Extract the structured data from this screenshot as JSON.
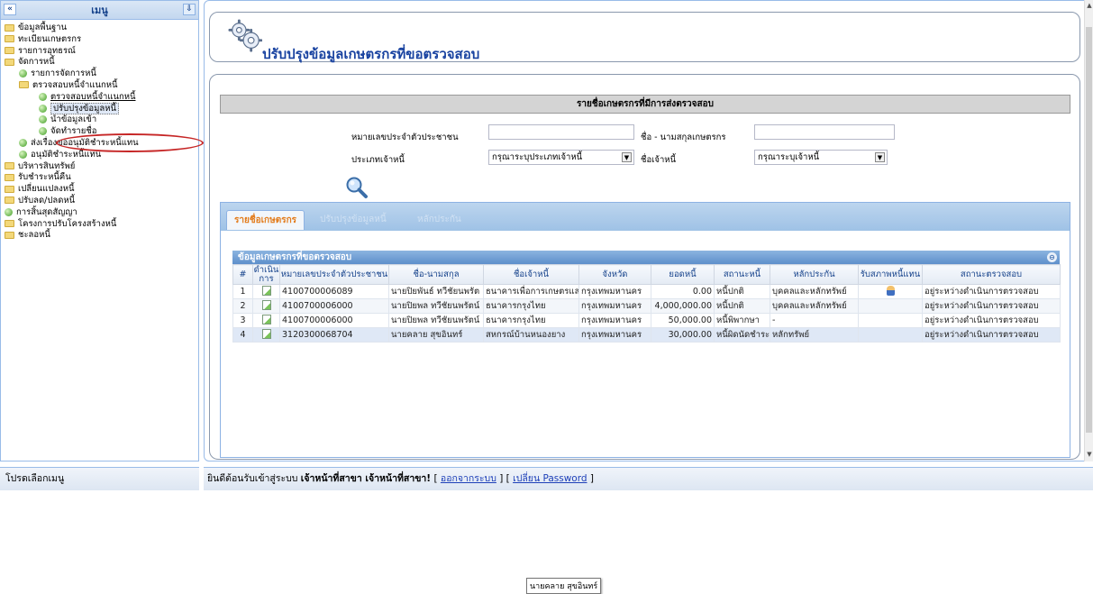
{
  "sidebar": {
    "title": "เมนู",
    "collapse_glyph": "«",
    "pin_glyph": "⇩",
    "items": [
      {
        "label": "ข้อมูลพื้นฐาน",
        "type": "folder"
      },
      {
        "label": "ทะเบียนเกษตรกร",
        "type": "folder"
      },
      {
        "label": "รายการอุทธรณ์",
        "type": "folder"
      },
      {
        "label": "จัดการหนี้",
        "type": "folder"
      },
      {
        "label": "รายการจัดการหนี้",
        "type": "leaf"
      },
      {
        "label": "ตรวจสอบหนี้จำแนกหนี้",
        "type": "folder"
      },
      {
        "label": "ตรวจสอบหนี้จำแนกหนี้",
        "type": "leaf"
      },
      {
        "label": "ปรับปรุงข้อมูลหนี้",
        "type": "leaf"
      },
      {
        "label": "นำข้อมูลเข้า",
        "type": "leaf"
      },
      {
        "label": "จัดทำรายชื่อ",
        "type": "leaf"
      },
      {
        "label": "ส่งเรื่องขออนุมัติชำระหนี้แทน",
        "type": "leaf"
      },
      {
        "label": "อนุมัติชำระหนี้แทน",
        "type": "leaf"
      },
      {
        "label": "บริหารสินทรัพย์",
        "type": "folder"
      },
      {
        "label": "รับชำระหนี้คืน",
        "type": "folder"
      },
      {
        "label": "เปลี่ยนแปลงหนี้",
        "type": "folder"
      },
      {
        "label": "ปรับลด/ปลดหนี้",
        "type": "folder"
      },
      {
        "label": "การสิ้นสุดสัญญา",
        "type": "leaf"
      },
      {
        "label": "โครงการปรับโครงสร้างหนี้",
        "type": "folder"
      },
      {
        "label": "ชะลอหนี้",
        "type": "folder"
      }
    ],
    "status": "โปรดเลือกเมนู"
  },
  "page": {
    "title": "ปรับปรุงข้อมูลเกษตรกรที่ขอตรวจสอบ",
    "list_title": "รายชื่อเกษตรกรที่มีการส่งตรวจสอบ"
  },
  "filters": {
    "id_label": "หมายเลขประจำตัวประชาชน",
    "name_label": "ชื่อ - นามสกุลเกษตรกร",
    "creditor_type_label": "ประเภทเจ้าหนี้",
    "creditor_type_value": "กรุณาระบุประเภทเจ้าหนี้",
    "creditor_label": "ชื่อเจ้าหนี้",
    "creditor_value": "กรุณาระบุเจ้าหนี้"
  },
  "tabs": [
    "รายชื่อเกษตรกร",
    "ปรับปรุงข้อมูลหนี้",
    "หลักประกัน"
  ],
  "grid": {
    "title": "ข้อมูลเกษตรกรที่ขอตรวจสอบ",
    "columns": [
      "#",
      "ดำเนินการ",
      "หมายเลขประจำตัวประชาชน",
      "ชื่อ-นามสกุล",
      "ชื่อเจ้าหนี้",
      "จังหวัด",
      "ยอดหนี้",
      "สถานะหนี้",
      "หลักประกัน",
      "รับสภาพหนี้แทน",
      "สถานะตรวจสอบ"
    ],
    "rows": [
      {
        "no": "1",
        "id": "4100700006089",
        "name": "นายปิยพันธ์ ทวีชัยนพรัต",
        "creditor": "ธนาคารเพื่อการเกษตรและสหกรณ์",
        "province": "กรุงเทพมหานคร",
        "amount": "0.00",
        "status": "หนี้ปกติ",
        "collateral": "บุคคลและหลักทรัพย์",
        "assume": "user-icon",
        "check": "อยู่ระหว่างดำเนินการตรวจสอบ"
      },
      {
        "no": "2",
        "id": "4100700006000",
        "name": "นายปิยพล ทวีชัยนพรัตน์",
        "creditor": "ธนาคารกรุงไทย",
        "province": "กรุงเทพมหานคร",
        "amount": "4,000,000.00",
        "status": "หนี้ปกติ",
        "collateral": "บุคคลและหลักทรัพย์",
        "assume": "",
        "check": "อยู่ระหว่างดำเนินการตรวจสอบ"
      },
      {
        "no": "3",
        "id": "4100700006000",
        "name": "นายปิยพล ทวีชัยนพรัตน์",
        "creditor": "ธนาคารกรุงไทย",
        "province": "กรุงเทพมหานคร",
        "amount": "50,000.00",
        "status": "หนี้พิพากษา",
        "collateral": "-",
        "assume": "",
        "check": "อยู่ระหว่างดำเนินการตรวจสอบ"
      },
      {
        "no": "4",
        "id": "3120300068704",
        "name": "นายคลาย สุขอินทร์",
        "creditor": "สหกรณ์บ้านหนองยาง",
        "province": "กรุงเทพมหานคร",
        "amount": "30,000.00",
        "status": "หนี้ผิดนัดชำระ",
        "collateral": "หลักทรัพย์",
        "assume": "",
        "check": "อยู่ระหว่างดำเนินการตรวจสอบ"
      }
    ],
    "tooltip": "นายคลาย สุขอินทร์"
  },
  "status_bar": {
    "welcome": "ยินดีต้อนรับเข้าสู่ระบบ",
    "user": "เจ้าหน้าที่สาขา เจ้าหน้าที่สาขา!",
    "open1": "[",
    "logout": "ออกจากระบบ",
    "close1": "] [",
    "change_pw": "เปลี่ยน Password",
    "close2": "]"
  }
}
